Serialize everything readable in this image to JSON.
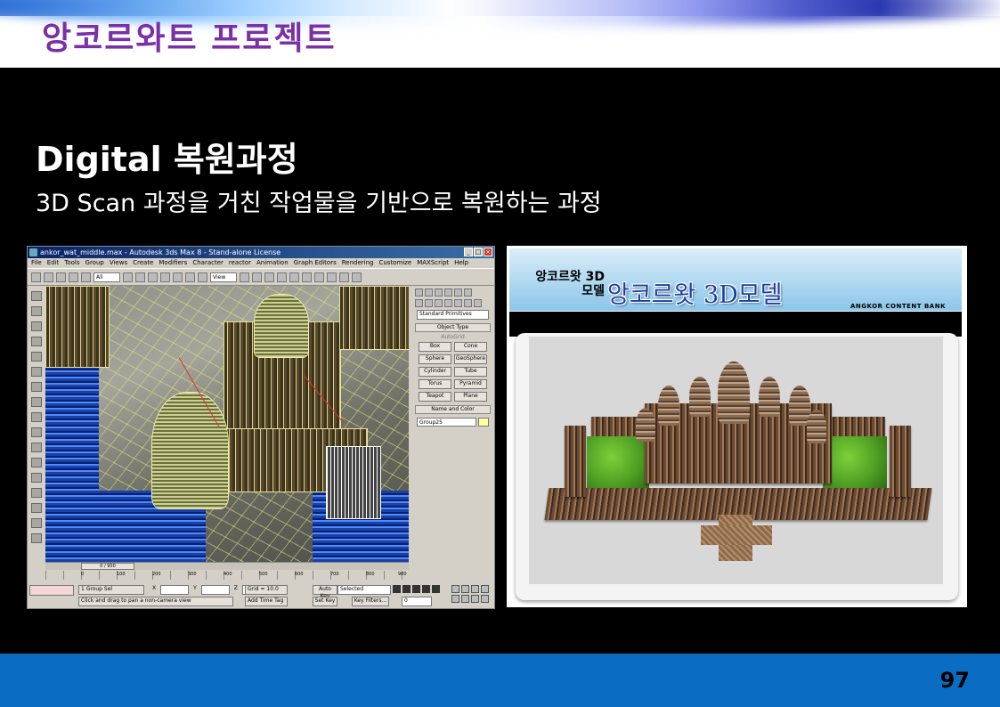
{
  "slide": {
    "title": "앙코르와트 프로젝트",
    "heading": "Digital 복원과정",
    "subheading": "3D Scan 과정을 거친 작업물을 기반으로 복원하는 과정",
    "page_number": "97"
  },
  "max_window": {
    "title": "ankor_wat_middle.max - Autodesk 3ds Max 8 - Stand-alone License",
    "menus": [
      "File",
      "Edit",
      "Tools",
      "Group",
      "Views",
      "Create",
      "Modifiers",
      "Character",
      "reactor",
      "Animation",
      "Graph Editors",
      "Rendering",
      "Customize",
      "MAXScript",
      "Help"
    ],
    "toolbar": {
      "filter": "All",
      "coord": "View"
    },
    "command_panel": {
      "dropdown": "Standard Primitives",
      "object_type_label": "Object Type",
      "autogrid_label": "AutoGrid",
      "primitives": [
        "Box",
        "Cone",
        "Sphere",
        "GeoSphere",
        "Cylinder",
        "Tube",
        "Torus",
        "Pyramid",
        "Teapot",
        "Plane"
      ],
      "name_color_label": "Name and Color",
      "object_name": "Group25"
    },
    "timeline": {
      "frame_slider": "0 / 900",
      "ruler_ticks": [
        "0",
        "100",
        "200",
        "300",
        "400",
        "500",
        "600",
        "700",
        "800",
        "900"
      ]
    },
    "status": {
      "selection": "1 Group Sel",
      "prompt": "Click and drag to pan a non-camera view",
      "x_label": "X",
      "y_label": "Y",
      "z_label": "Z",
      "grid": "Grid = 10.0",
      "add_time_tag": "Add Time Tag",
      "auto_key": "Auto Key",
      "selected": "Selected",
      "set_key": "Set Key",
      "key_filters": "Key Filters...",
      "current_frame": "0"
    }
  },
  "angkor_panel": {
    "small_title_line1": "앙코르왓 3D",
    "small_title_line2": "모델",
    "big_title": "앙코르왓 3D모델",
    "bank_label": "ANGKOR CONTENT BANK"
  }
}
